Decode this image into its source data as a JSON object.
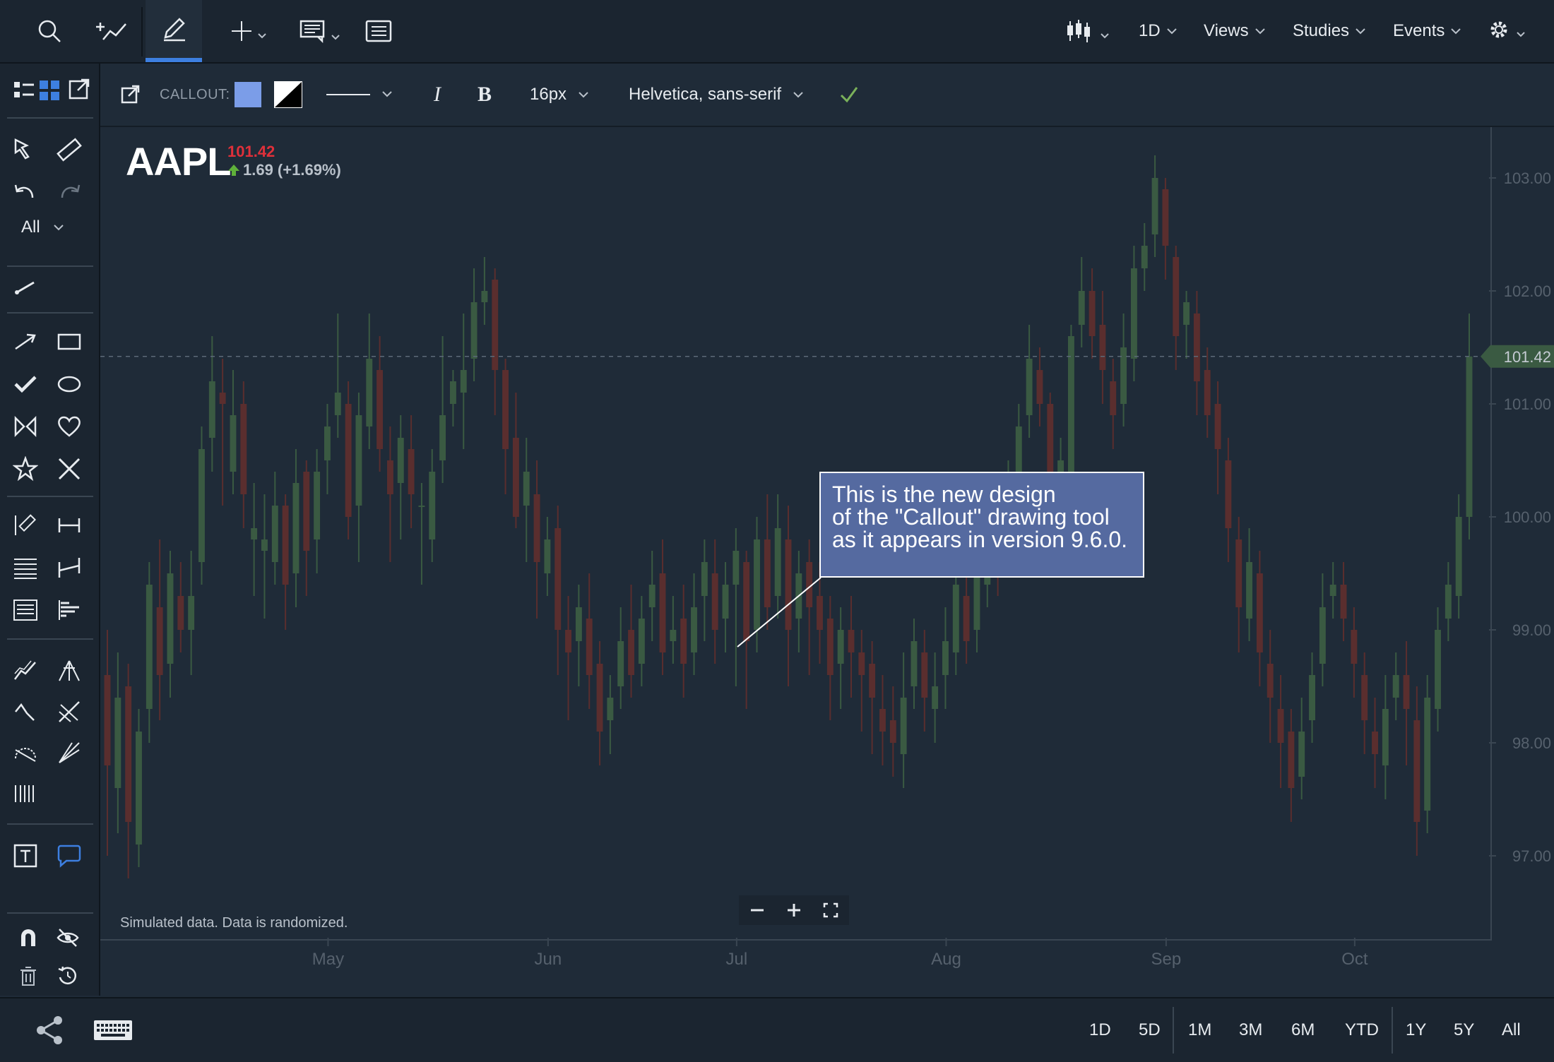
{
  "toolbar": {
    "interval": "1D",
    "views": "Views",
    "studies": "Studies",
    "events": "Events"
  },
  "sidebar": {
    "filter_label": "All"
  },
  "drawing_toolbar": {
    "tool_label": "CALLOUT:",
    "fill_color": "#7b9de8",
    "font_size": "16px",
    "font_family": "Helvetica, sans-serif",
    "italic": "I",
    "bold": "B"
  },
  "chart_header": {
    "symbol": "AAPL",
    "price": "101.42",
    "change": "1.69 (+1.69%)"
  },
  "callout": {
    "lines": [
      "This is the new design",
      "of the \"Callout\" drawing tool",
      "as it appears in version 9.6.0."
    ]
  },
  "footnote": "Simulated data.  Data is randomized.",
  "bottombar": {
    "ranges": [
      "1D",
      "5D",
      "1M",
      "3M",
      "6M",
      "YTD",
      "1Y",
      "5Y",
      "All"
    ]
  },
  "colors": {
    "background": "#1f2b38",
    "up_candle": "#3a5a42",
    "down_candle": "#5a2e2e",
    "accent": "#3d7fe0",
    "price_label": "#e0303a",
    "callout_fill": "#556aa0"
  },
  "chart_data": {
    "type": "candlestick",
    "symbol": "AAPL",
    "last_price": 101.42,
    "ylim": [
      96.2,
      103.4
    ],
    "y_ticks": [
      "103.00",
      "102.00",
      "101.00",
      "100.00",
      "99.00",
      "98.00",
      "97.00"
    ],
    "current_price_label": "101.42",
    "x_ticks": [
      "May",
      "Jun",
      "Jul",
      "Aug",
      "Sep",
      "Oct"
    ],
    "grid": false,
    "candles": [
      [
        98.6,
        97.8,
        99.0,
        97.0
      ],
      [
        97.6,
        98.4,
        98.8,
        97.2
      ],
      [
        98.5,
        97.3,
        98.7,
        96.8
      ],
      [
        97.1,
        98.1,
        98.3,
        96.9
      ],
      [
        98.3,
        99.4,
        99.6,
        98.0
      ],
      [
        99.2,
        98.6,
        99.8,
        98.2
      ],
      [
        98.7,
        99.5,
        99.7,
        98.4
      ],
      [
        99.3,
        99.0,
        99.6,
        98.8
      ],
      [
        99.0,
        99.3,
        99.7,
        98.6
      ],
      [
        99.6,
        100.6,
        100.8,
        99.4
      ],
      [
        100.7,
        101.2,
        101.6,
        100.4
      ],
      [
        101.1,
        101.0,
        101.4,
        100.1
      ],
      [
        100.4,
        100.9,
        101.3,
        100.2
      ],
      [
        101.0,
        100.2,
        101.2,
        99.9
      ],
      [
        99.8,
        99.9,
        100.3,
        99.3
      ],
      [
        99.7,
        99.8,
        100.2,
        99.1
      ],
      [
        99.6,
        100.1,
        100.4,
        99.4
      ],
      [
        100.1,
        99.4,
        100.2,
        99.0
      ],
      [
        99.5,
        100.3,
        100.6,
        99.2
      ],
      [
        100.4,
        99.7,
        100.5,
        99.3
      ],
      [
        99.8,
        100.4,
        100.6,
        99.5
      ],
      [
        100.5,
        100.8,
        101.0,
        100.2
      ],
      [
        100.9,
        101.1,
        101.8,
        100.7
      ],
      [
        101.0,
        100.0,
        101.2,
        99.8
      ],
      [
        100.1,
        100.9,
        101.1,
        99.6
      ],
      [
        100.8,
        101.4,
        101.8,
        100.6
      ],
      [
        101.3,
        100.6,
        101.6,
        100.4
      ],
      [
        100.5,
        100.2,
        100.8,
        99.6
      ],
      [
        100.3,
        100.7,
        100.9,
        99.8
      ],
      [
        100.6,
        100.2,
        100.9,
        99.9
      ],
      [
        100.1,
        100.1,
        100.3,
        99.4
      ],
      [
        99.8,
        100.4,
        100.6,
        99.6
      ],
      [
        100.5,
        100.9,
        101.6,
        100.3
      ],
      [
        101.0,
        101.2,
        101.3,
        100.8
      ],
      [
        101.1,
        101.3,
        101.8,
        100.6
      ],
      [
        101.4,
        101.9,
        102.2,
        101.2
      ],
      [
        101.9,
        102.0,
        102.3,
        101.7
      ],
      [
        102.1,
        101.3,
        102.2,
        100.9
      ],
      [
        101.3,
        100.6,
        101.4,
        100.2
      ],
      [
        100.7,
        100.0,
        101.1,
        99.9
      ],
      [
        100.1,
        100.4,
        100.7,
        99.6
      ],
      [
        100.2,
        99.6,
        100.5,
        99.1
      ],
      [
        99.5,
        99.8,
        100.0,
        99.3
      ],
      [
        99.9,
        99.0,
        100.1,
        98.6
      ],
      [
        99.0,
        98.8,
        99.3,
        98.2
      ],
      [
        98.9,
        99.2,
        99.4,
        98.5
      ],
      [
        99.1,
        98.6,
        99.5,
        98.3
      ],
      [
        98.7,
        98.1,
        98.9,
        97.8
      ],
      [
        98.2,
        98.4,
        98.6,
        97.9
      ],
      [
        98.5,
        98.9,
        99.2,
        98.3
      ],
      [
        99.0,
        98.6,
        99.4,
        98.4
      ],
      [
        98.7,
        99.1,
        99.3,
        98.5
      ],
      [
        99.2,
        99.4,
        99.7,
        98.9
      ],
      [
        99.5,
        98.8,
        99.8,
        98.6
      ],
      [
        98.9,
        99.0,
        99.3,
        98.7
      ],
      [
        99.1,
        98.7,
        99.4,
        98.4
      ],
      [
        98.8,
        99.2,
        99.5,
        98.6
      ],
      [
        99.3,
        99.6,
        99.8,
        98.9
      ],
      [
        99.5,
        99.0,
        99.8,
        98.7
      ],
      [
        99.1,
        99.4,
        99.6,
        98.8
      ],
      [
        99.4,
        99.7,
        99.9,
        98.5
      ],
      [
        99.6,
        98.9,
        99.7,
        98.3
      ],
      [
        99.0,
        99.8,
        100.0,
        98.8
      ],
      [
        99.8,
        99.2,
        100.2,
        99.0
      ],
      [
        99.3,
        99.9,
        100.2,
        99.1
      ],
      [
        99.8,
        99.0,
        100.1,
        98.5
      ],
      [
        99.1,
        99.5,
        99.7,
        98.8
      ],
      [
        99.6,
        99.2,
        99.8,
        98.6
      ],
      [
        99.3,
        99.0,
        99.6,
        98.7
      ],
      [
        99.1,
        98.6,
        99.3,
        98.2
      ],
      [
        98.7,
        99.0,
        99.2,
        98.3
      ],
      [
        99.0,
        98.8,
        99.3,
        98.4
      ],
      [
        98.8,
        98.6,
        99.0,
        98.1
      ],
      [
        98.7,
        98.4,
        98.9,
        97.9
      ],
      [
        98.3,
        98.1,
        98.6,
        97.8
      ],
      [
        98.2,
        98.0,
        98.5,
        97.7
      ],
      [
        97.9,
        98.4,
        98.8,
        97.6
      ],
      [
        98.5,
        98.9,
        99.1,
        98.3
      ],
      [
        98.8,
        98.4,
        99.0,
        98.1
      ],
      [
        98.3,
        98.5,
        98.8,
        98.0
      ],
      [
        98.6,
        98.9,
        99.2,
        98.3
      ],
      [
        98.8,
        99.4,
        99.6,
        98.6
      ],
      [
        99.3,
        98.9,
        99.5,
        98.7
      ],
      [
        99.0,
        99.5,
        99.8,
        98.8
      ],
      [
        99.4,
        100.0,
        100.3,
        99.2
      ],
      [
        100.1,
        99.6,
        100.2,
        99.3
      ],
      [
        99.7,
        100.3,
        100.5,
        99.5
      ],
      [
        100.2,
        100.8,
        101.0,
        100.0
      ],
      [
        100.9,
        101.4,
        101.7,
        100.7
      ],
      [
        101.3,
        101.0,
        101.5,
        100.8
      ],
      [
        101.0,
        100.4,
        101.1,
        100.1
      ],
      [
        100.3,
        100.5,
        100.7,
        100.0
      ],
      [
        100.4,
        101.6,
        101.7,
        100.2
      ],
      [
        101.7,
        102.0,
        102.3,
        101.5
      ],
      [
        102.0,
        101.6,
        102.2,
        101.4
      ],
      [
        101.7,
        101.3,
        102.0,
        101.0
      ],
      [
        101.2,
        100.9,
        101.4,
        100.6
      ],
      [
        101.0,
        101.5,
        101.8,
        100.8
      ],
      [
        101.4,
        102.2,
        102.4,
        101.2
      ],
      [
        102.2,
        102.4,
        102.6,
        102.0
      ],
      [
        102.5,
        103.0,
        103.2,
        102.3
      ],
      [
        102.9,
        102.4,
        103.0,
        102.1
      ],
      [
        102.3,
        101.6,
        102.4,
        101.3
      ],
      [
        101.7,
        101.9,
        102.0,
        101.4
      ],
      [
        101.8,
        101.2,
        102.0,
        100.9
      ],
      [
        101.3,
        100.9,
        101.5,
        100.7
      ],
      [
        101.0,
        100.6,
        101.2,
        100.2
      ],
      [
        100.5,
        99.9,
        100.7,
        99.6
      ],
      [
        99.8,
        99.2,
        100.0,
        98.8
      ],
      [
        99.1,
        99.6,
        99.9,
        98.9
      ],
      [
        99.5,
        98.8,
        99.7,
        98.5
      ],
      [
        98.7,
        98.4,
        99.0,
        98.0
      ],
      [
        98.3,
        98.0,
        98.6,
        97.6
      ],
      [
        98.1,
        97.6,
        98.3,
        97.3
      ],
      [
        97.7,
        98.1,
        98.4,
        97.5
      ],
      [
        98.2,
        98.6,
        98.8,
        98.0
      ],
      [
        98.7,
        99.2,
        99.5,
        98.5
      ],
      [
        99.3,
        99.4,
        99.6,
        99.1
      ],
      [
        99.4,
        99.1,
        99.6,
        98.9
      ],
      [
        99.0,
        98.7,
        99.2,
        98.4
      ],
      [
        98.6,
        98.2,
        98.8,
        97.9
      ],
      [
        98.1,
        97.9,
        98.4,
        97.6
      ],
      [
        97.8,
        98.3,
        98.6,
        97.5
      ],
      [
        98.4,
        98.6,
        98.8,
        98.2
      ],
      [
        98.6,
        98.3,
        98.9,
        97.8
      ],
      [
        98.2,
        97.3,
        98.5,
        97.0
      ],
      [
        97.4,
        98.4,
        98.6,
        97.2
      ],
      [
        98.3,
        99.0,
        99.2,
        98.1
      ],
      [
        99.1,
        99.4,
        99.6,
        98.9
      ],
      [
        99.3,
        100.0,
        100.2,
        99.1
      ],
      [
        100.0,
        101.42,
        101.8,
        99.8
      ]
    ]
  }
}
